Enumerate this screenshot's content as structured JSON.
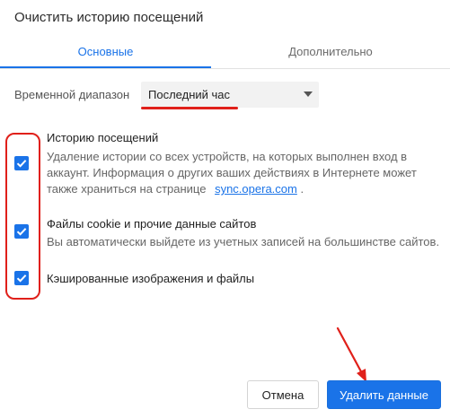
{
  "dialog": {
    "title": "Очистить историю посещений"
  },
  "tabs": [
    {
      "label": "Основные",
      "active": true
    },
    {
      "label": "Дополнительно",
      "active": false
    }
  ],
  "time_range": {
    "label": "Временной диапазон",
    "selected": "Последний час"
  },
  "items": [
    {
      "title": "Историю посещений",
      "description": "Удаление истории со всех устройств, на которых выполнен вход в аккаунт. Информация о других ваших действиях в Интернете может также храниться на странице",
      "link_text": "sync.opera.com",
      "suffix": ".",
      "checked": true
    },
    {
      "title": "Файлы cookie и прочие данные сайтов",
      "description": "Вы автоматически выйдете из учетных записей на большинстве сайтов.",
      "checked": true
    },
    {
      "title": "Кэшированные изображения и файлы",
      "checked": true
    }
  ],
  "buttons": {
    "cancel": "Отмена",
    "clear": "Удалить данные"
  },
  "colors": {
    "accent": "#1a73e8",
    "annotation_red": "#e0201a"
  },
  "icons": {
    "checkbox": "check-icon",
    "dropdown": "chevron-down-icon",
    "annotation_arrow": "red-arrow-icon"
  }
}
